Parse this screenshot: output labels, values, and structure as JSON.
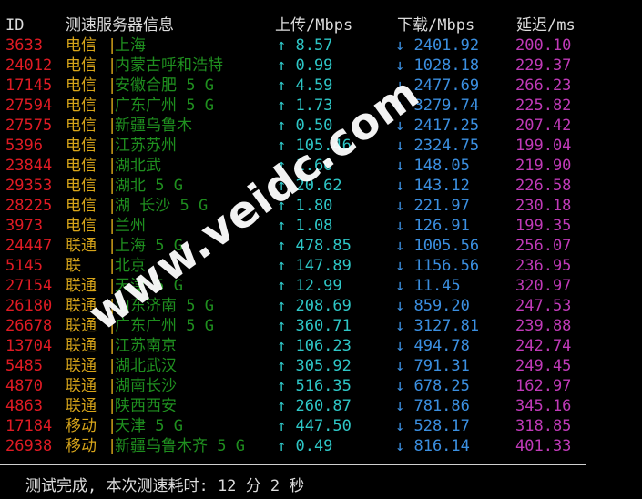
{
  "header": {
    "id": "ID",
    "server_info": "测速服务器信息",
    "upload": "上传/Mbps",
    "download": "下载/Mbps",
    "latency": "延迟/ms"
  },
  "separator_char": "|",
  "rows": [
    {
      "id": "3633",
      "isp": "电信",
      "loc": "上海",
      "up_arrow": "↑",
      "up": "8.57",
      "down_arrow": "↓",
      "down": "2401.92",
      "lat": "200.10"
    },
    {
      "id": "24012",
      "isp": "电信",
      "loc": "内蒙古呼和浩特",
      "up_arrow": "↑",
      "up": "0.99",
      "down_arrow": "↓",
      "down": "1028.18",
      "lat": "229.37"
    },
    {
      "id": "17145",
      "isp": "电信",
      "loc": "安徽合肥 5 G",
      "up_arrow": "↑",
      "up": "4.59",
      "down_arrow": "↓",
      "down": "2477.69",
      "lat": "266.23"
    },
    {
      "id": "27594",
      "isp": "电信",
      "loc": "广东广州 5 G",
      "up_arrow": "↑",
      "up": "1.73",
      "down_arrow": "↓",
      "down": "3279.74",
      "lat": "225.82"
    },
    {
      "id": "27575",
      "isp": "电信",
      "loc": "新疆乌鲁木",
      "up_arrow": "↑",
      "up": "0.50",
      "down_arrow": "↓",
      "down": "2417.25",
      "lat": "207.42"
    },
    {
      "id": "5396",
      "isp": "电信",
      "loc": "江苏苏州",
      "up_arrow": "↑",
      "up": "105.46",
      "down_arrow": "↓",
      "down": "2324.75",
      "lat": "199.04"
    },
    {
      "id": "23844",
      "isp": "电信",
      "loc": "湖北武",
      "up_arrow": "↑",
      "up": "1.60",
      "down_arrow": "↓",
      "down": "148.05",
      "lat": "219.90"
    },
    {
      "id": "29353",
      "isp": "电信",
      "loc": "湖北 5 G",
      "up_arrow": "↑",
      "up": "20.62",
      "down_arrow": "↓",
      "down": "143.12",
      "lat": "226.58"
    },
    {
      "id": "28225",
      "isp": "电信",
      "loc": "湖 长沙 5 G",
      "up_arrow": "↑",
      "up": "1.80",
      "down_arrow": "↓",
      "down": "221.97",
      "lat": "230.18"
    },
    {
      "id": "3973",
      "isp": "电信",
      "loc": "兰州",
      "up_arrow": "↑",
      "up": "1.08",
      "down_arrow": "↓",
      "down": "126.91",
      "lat": "199.35"
    },
    {
      "id": "24447",
      "isp": "联通",
      "loc": "上海 5 G",
      "up_arrow": "↑",
      "up": "478.85",
      "down_arrow": "↓",
      "down": "1005.56",
      "lat": "256.07"
    },
    {
      "id": "5145",
      "isp": "联",
      "loc": "北京",
      "up_arrow": "↑",
      "up": "147.89",
      "down_arrow": "↓",
      "down": "1156.56",
      "lat": "236.95"
    },
    {
      "id": "27154",
      "isp": "联通",
      "loc": "天津 5 G",
      "up_arrow": "↑",
      "up": "12.99",
      "down_arrow": "↓",
      "down": "11.45",
      "lat": "320.97"
    },
    {
      "id": "26180",
      "isp": "联通",
      "loc": "山东济南 5 G",
      "up_arrow": "↑",
      "up": "208.69",
      "down_arrow": "↓",
      "down": "859.20",
      "lat": "247.53"
    },
    {
      "id": "26678",
      "isp": "联通",
      "loc": "广东广州 5 G",
      "up_arrow": "↑",
      "up": "360.71",
      "down_arrow": "↓",
      "down": "3127.81",
      "lat": "239.88"
    },
    {
      "id": "13704",
      "isp": "联通",
      "loc": "江苏南京",
      "up_arrow": "↑",
      "up": "106.23",
      "down_arrow": "↓",
      "down": "494.78",
      "lat": "242.74"
    },
    {
      "id": "5485",
      "isp": "联通",
      "loc": "湖北武汉",
      "up_arrow": "↑",
      "up": "305.92",
      "down_arrow": "↓",
      "down": "791.31",
      "lat": "249.45"
    },
    {
      "id": "4870",
      "isp": "联通",
      "loc": "湖南长沙",
      "up_arrow": "↑",
      "up": "516.35",
      "down_arrow": "↓",
      "down": "678.25",
      "lat": "162.97"
    },
    {
      "id": "4863",
      "isp": "联通",
      "loc": "陕西西安",
      "up_arrow": "↑",
      "up": "260.87",
      "down_arrow": "↓",
      "down": "781.86",
      "lat": "345.16"
    },
    {
      "id": "17184",
      "isp": "移动",
      "loc": "天津 5 G",
      "up_arrow": "↑",
      "up": "447.50",
      "down_arrow": "↓",
      "down": "528.17",
      "lat": "318.85"
    },
    {
      "id": "26938",
      "isp": "移动",
      "loc": "新疆乌鲁木齐 5 G",
      "up_arrow": "↑",
      "up": "0.49",
      "down_arrow": "↓",
      "down": "816.14",
      "lat": "401.33"
    }
  ],
  "footer": "测试完成, 本次测速耗时: 12 分 2 秒",
  "watermark": "www.veidc.com",
  "colors": {
    "background": "#000000",
    "id": "#e01b24",
    "isp": "#d7a51a",
    "location": "#1f8f1f",
    "upload": "#2ec6c6",
    "download": "#3b8fe0",
    "latency": "#c03ab8"
  }
}
